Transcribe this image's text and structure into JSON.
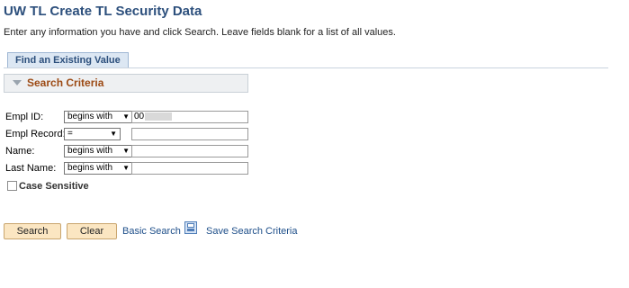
{
  "page": {
    "title": "UW TL Create TL Security Data",
    "instructions": "Enter any information you have and click Search. Leave fields blank for a list of all values."
  },
  "tabs": [
    {
      "label": "Find an Existing Value"
    }
  ],
  "section": {
    "label": "Search Criteria"
  },
  "fields": {
    "empl_id": {
      "label": "Empl ID:",
      "operator": "begins with",
      "value": "00"
    },
    "empl_record": {
      "label": "Empl Record:",
      "operator": "=",
      "value": ""
    },
    "name": {
      "label": "Name:",
      "operator": "begins with",
      "value": ""
    },
    "last_name": {
      "label": "Last Name:",
      "operator": "begins with",
      "value": ""
    }
  },
  "case_sensitive": {
    "label": "Case Sensitive",
    "checked": false
  },
  "buttons": {
    "search": "Search",
    "clear": "Clear"
  },
  "links": {
    "basic_search": "Basic Search",
    "save_search": "Save Search Criteria"
  },
  "icons": {
    "save": "save-icon",
    "dropdown": "chevron-down-icon",
    "collapse": "triangle-down-icon"
  }
}
